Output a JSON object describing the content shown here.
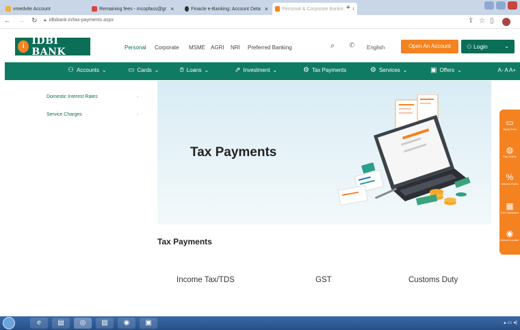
{
  "browser": {
    "tabs": [
      {
        "label": "vmedvite Account",
        "fav_color": "#e9b437",
        "active": false
      },
      {
        "label": "Remaining fees - mcopfass@gr",
        "fav_color": "#d9453b",
        "active": false
      },
      {
        "label": "Finacle e-Banking: Account Deta",
        "fav_color": "#333333",
        "active": false
      },
      {
        "label": "Personal & Corporate Banking",
        "fav_color": "#f58220",
        "active": true
      }
    ],
    "new_tab": "+",
    "url": "idbibank.in/tax-payments.aspx"
  },
  "header": {
    "logo_text": "IDBI BANK",
    "logo_mark": "i",
    "nav": [
      "Personal",
      "Corporate",
      "MSME",
      "AGRI",
      "NRI",
      "Preferred Banking"
    ],
    "language": "English",
    "open_account": "Open An Account",
    "login": "Login"
  },
  "menu": {
    "items": [
      {
        "label": "Accounts",
        "icon": "person-icon"
      },
      {
        "label": "Cards",
        "icon": "card-icon"
      },
      {
        "label": "Loans",
        "icon": "hand-coin-icon"
      },
      {
        "label": "Investment",
        "icon": "growth-icon"
      },
      {
        "label": "Tax Payments",
        "icon": "tax-icon"
      },
      {
        "label": "Services",
        "icon": "service-icon"
      },
      {
        "label": "Offers",
        "icon": "gift-icon"
      }
    ],
    "font_controls": "A- A A+"
  },
  "side_menu": [
    "Domestic Interest Rates",
    "Service Charges"
  ],
  "banner": {
    "title": "Tax Payments"
  },
  "float_bar": [
    {
      "label": "Apply Now",
      "icon": "laptop-icon"
    },
    {
      "label": "Pay Online",
      "icon": "globe-icon"
    },
    {
      "label": "Interest Rates",
      "icon": "percent-icon"
    },
    {
      "label": "EMI Calculator",
      "icon": "calculator-icon"
    },
    {
      "label": "Branch Locator",
      "icon": "location-icon"
    }
  ],
  "content": {
    "section_title": "Tax Payments",
    "payment_links": [
      "Income Tax/TDS",
      "GST",
      "Customs Duty"
    ]
  },
  "colors": {
    "brand_green": "#0f7b62",
    "brand_orange": "#f58220"
  }
}
